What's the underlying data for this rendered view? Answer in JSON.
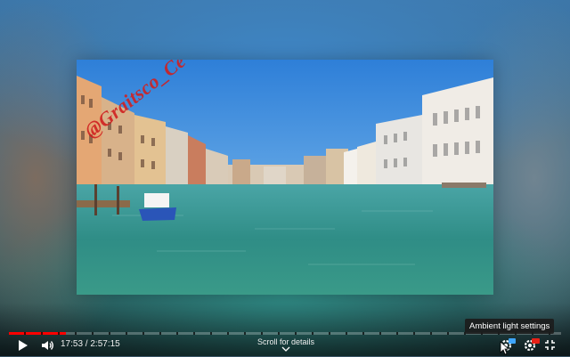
{
  "watermark": "@Graitsco_Ce",
  "player": {
    "current_time": "17:53",
    "separator": " / ",
    "duration": "2:57:15",
    "progress_fraction": 0.103,
    "scroll_hint": "Scroll for details",
    "tooltip": "Ambient light settings"
  },
  "icons": {
    "play": "play-icon",
    "volume": "volume-icon",
    "ambient": "ambient-light-icon",
    "settings": "settings-hd-icon",
    "fullscreen": "fullscreen-icon",
    "chevron": "chevron-down-icon",
    "cursor": "mouse-cursor-icon"
  },
  "colors": {
    "progress_played": "#ff0000",
    "badge_red": "#e62117",
    "badge_blue": "#3ea6ff",
    "sky": "#3b8be0",
    "water": "#2f8f8a"
  }
}
